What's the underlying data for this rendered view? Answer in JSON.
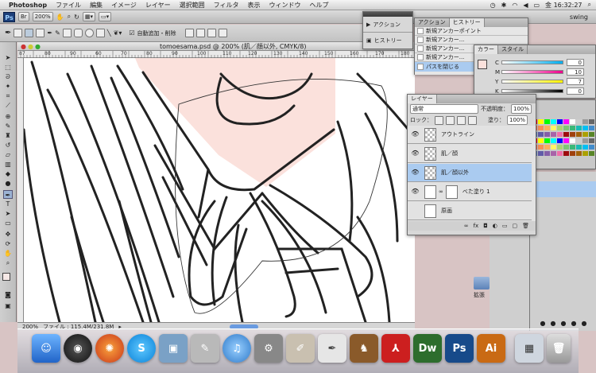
{
  "menubar": {
    "apple": "",
    "app_name": "Photoshop",
    "items": [
      "ファイル",
      "編集",
      "イメージ",
      "レイヤー",
      "選択範囲",
      "フィルタ",
      "表示",
      "ウィンドウ",
      "ヘルプ"
    ],
    "clock": "金 16:32:27",
    "battery_icon": "battery-icon",
    "wifi_icon": "wifi-icon"
  },
  "appbar": {
    "ps_badge": "Ps",
    "zoom": "200%",
    "workspace": "swing"
  },
  "options": {
    "auto_add_delete_label": "自動追加・削除"
  },
  "document": {
    "title": "tomoesama.psd @ 200% (肌／顔以外, CMYK/8)",
    "status_zoom": "200%",
    "status_file": "ファイル : 115.4M/231.8M",
    "ruler_ticks": [
      "87",
      "80",
      "90",
      "60",
      "70",
      "80",
      "90",
      "100",
      "110",
      "120",
      "130",
      "140",
      "150",
      "160",
      "170",
      "180"
    ]
  },
  "actions_panel": {
    "action_label": "アクション",
    "history_label": "ヒストリー"
  },
  "history_panel": {
    "tabs": [
      "アクション",
      "ヒストリー"
    ],
    "items": [
      "新規アンカーポイント",
      "新規アンカー...",
      "新規アンカー...",
      "新規アンカー...",
      "パスを閉じる"
    ]
  },
  "color_panel": {
    "tabs": [
      "カラー",
      "スタイル"
    ],
    "channels": [
      {
        "label": "C",
        "value": "0"
      },
      {
        "label": "M",
        "value": "10"
      },
      {
        "label": "Y",
        "value": "7"
      },
      {
        "label": "K",
        "value": "0"
      }
    ]
  },
  "layers_panel": {
    "title": "レイヤー",
    "blend_mode": "通常",
    "opacity_label": "不透明度：",
    "opacity_value": "100%",
    "lock_label": "ロック：",
    "fill_label": "塗り：",
    "fill_value": "100%",
    "layers": [
      {
        "name": "アウトライン",
        "selected": false,
        "visible": true
      },
      {
        "name": "肌／顔",
        "selected": false,
        "visible": true
      },
      {
        "name": "肌／顔以外",
        "selected": true,
        "visible": true
      },
      {
        "name": "べた塗り 1",
        "selected": false,
        "visible": true
      },
      {
        "name": "原画",
        "selected": false,
        "visible": false
      }
    ]
  },
  "desktop": {
    "folder_label": "拡張"
  },
  "dock": {
    "icons": [
      "finder-icon",
      "dashboard-icon",
      "firefox-icon",
      "skype-icon",
      "iphoto-icon",
      "preview-icon",
      "itunes-icon",
      "system-preferences-icon",
      "script-editor-icon",
      "textedit-icon",
      "gnu-icon",
      "acrobat-icon",
      "dreamweaver-icon",
      "photoshop-icon",
      "illustrator-icon",
      "finder-window-icon",
      "trash-icon"
    ],
    "labels": {
      "dw": "Dw",
      "ps": "Ps",
      "ai": "Ai"
    }
  },
  "colors": {
    "skin": "#fbe1dc",
    "selection": "#aacbf0",
    "dw": "#2d6d2d",
    "ps": "#174a8a",
    "ai": "#c96a14"
  }
}
